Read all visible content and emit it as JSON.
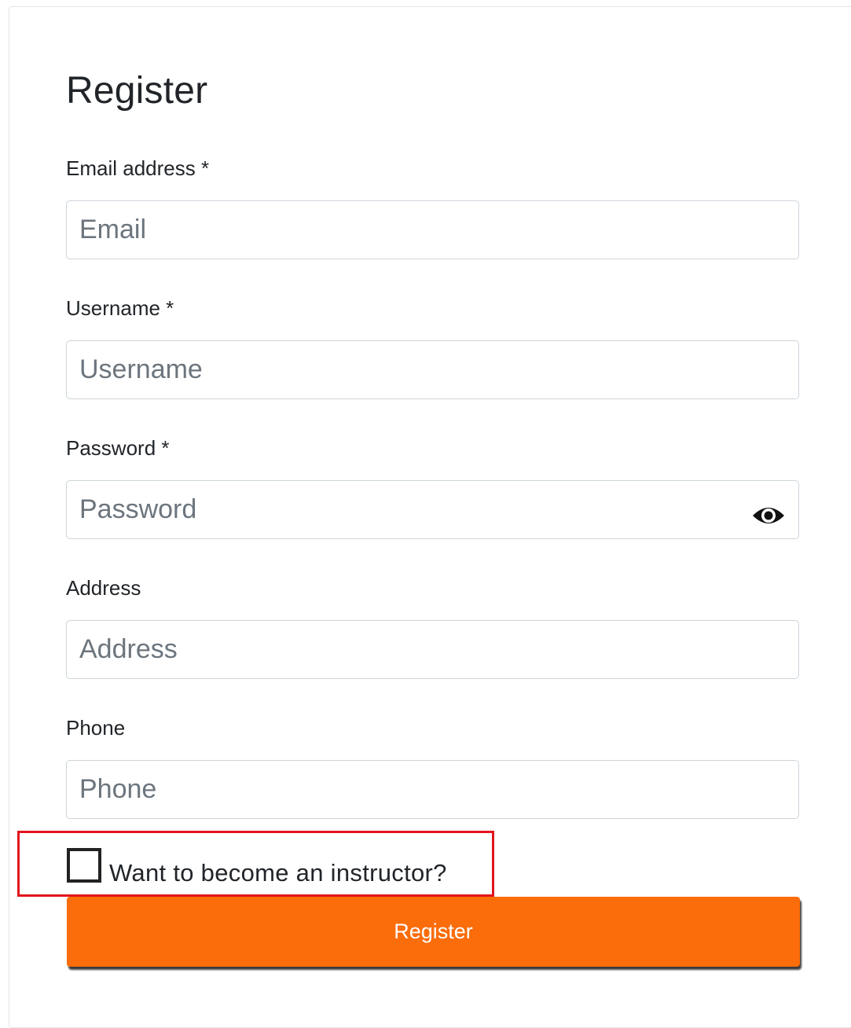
{
  "form": {
    "title": "Register",
    "fields": {
      "email": {
        "label": "Email address *",
        "placeholder": "Email"
      },
      "username": {
        "label": "Username *",
        "placeholder": "Username"
      },
      "password": {
        "label": "Password *",
        "placeholder": "Password"
      },
      "address": {
        "label": "Address",
        "placeholder": "Address"
      },
      "phone": {
        "label": "Phone",
        "placeholder": "Phone"
      }
    },
    "instructor_checkbox": {
      "label": "Want to become an instructor?",
      "checked": false
    },
    "submit_label": "Register"
  },
  "icons": {
    "password_toggle": "eye-icon"
  },
  "colors": {
    "accent": "#fb6c0a",
    "highlight": "#e3141c"
  }
}
